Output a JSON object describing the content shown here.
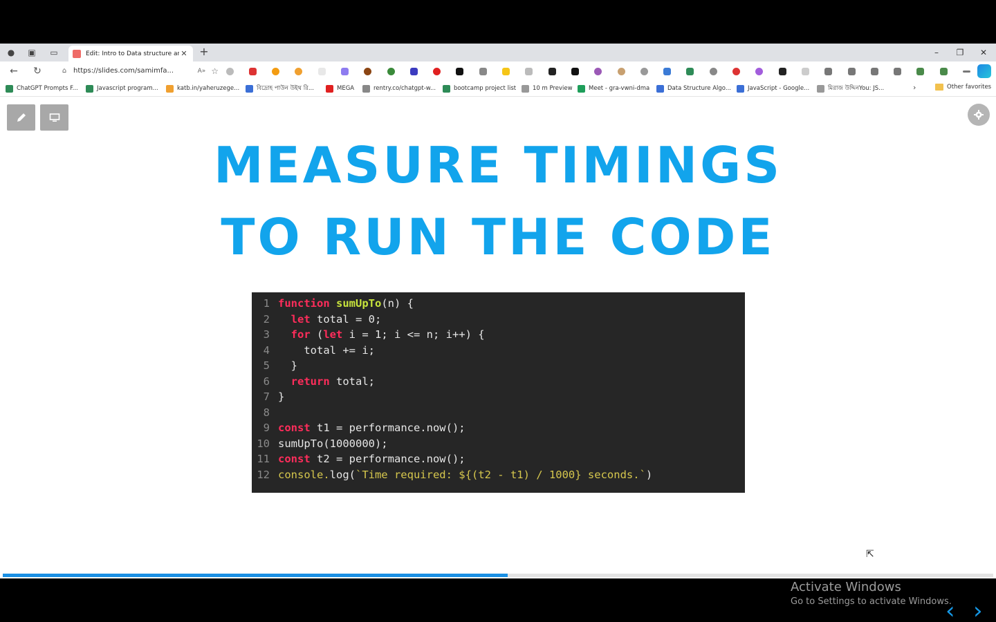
{
  "tab": {
    "title": "Edit: Intro to Data structure and",
    "close": "✕"
  },
  "new_tab": "+",
  "window_controls": {
    "minimize": "–",
    "restore": "❐",
    "close": "✕"
  },
  "nav": {
    "back": "←",
    "refresh": "↻"
  },
  "address": {
    "url": "https://slides.com/samimfa...",
    "read_aloud": "A»",
    "lock": "🔒"
  },
  "bookmarks": [
    {
      "label": "ChatGPT Prompts F...",
      "color": "#2e8b57"
    },
    {
      "label": "Javascript program...",
      "color": "#2e8b57"
    },
    {
      "label": "katb.in/yaheruzege...",
      "color": "#f0a030"
    },
    {
      "label": "বিদ্রোহ পাউন উইথ রি...",
      "color": "#3b6fd6"
    },
    {
      "label": "MEGA",
      "color": "#e02020"
    },
    {
      "label": "rentry.co/chatgpt-w...",
      "color": "#888888"
    },
    {
      "label": "bootcamp project list",
      "color": "#2e8b57"
    },
    {
      "label": "10 m Preview",
      "color": "#999999"
    },
    {
      "label": "Meet - gra-vwni-dma",
      "color": "#1e9e5a"
    },
    {
      "label": "Data Structure Algo...",
      "color": "#3b6fd6"
    },
    {
      "label": "JavaScript - Google...",
      "color": "#3b6fd6"
    },
    {
      "label": "মিরাজ উদ্দিনYou: JS...",
      "color": "#999999"
    }
  ],
  "bookmarks_more": "›",
  "other_favorites": "Other favorites",
  "slide": {
    "heading_line1": "MEASURE TIMINGS",
    "heading_line2": "TO RUN THE CODE",
    "heading_color": "#12a4ec",
    "code_lines": [
      {
        "n": "1",
        "parts": [
          [
            "kw",
            "function"
          ],
          [
            "c",
            " "
          ],
          [
            "fn",
            "sumUpTo"
          ],
          [
            "c",
            "(n) {"
          ]
        ]
      },
      {
        "n": "2",
        "parts": [
          [
            "c",
            "  "
          ],
          [
            "kw",
            "let"
          ],
          [
            "c",
            " total = 0;"
          ]
        ]
      },
      {
        "n": "3",
        "parts": [
          [
            "c",
            "  "
          ],
          [
            "kw",
            "for"
          ],
          [
            "c",
            " ("
          ],
          [
            "kw",
            "let"
          ],
          [
            "c",
            " i = 1; i <= n; i++) {"
          ]
        ]
      },
      {
        "n": "4",
        "parts": [
          [
            "c",
            "    total += i;"
          ]
        ]
      },
      {
        "n": "5",
        "parts": [
          [
            "c",
            "  }"
          ]
        ]
      },
      {
        "n": "6",
        "parts": [
          [
            "c",
            "  "
          ],
          [
            "kw",
            "return"
          ],
          [
            "c",
            " total;"
          ]
        ]
      },
      {
        "n": "7",
        "parts": [
          [
            "c",
            "}"
          ]
        ]
      },
      {
        "n": "8",
        "parts": []
      },
      {
        "n": "9",
        "parts": [
          [
            "kw",
            "const"
          ],
          [
            "c",
            " t1 = performance.now();"
          ]
        ]
      },
      {
        "n": "10",
        "parts": [
          [
            "c",
            "sumUpTo(1000000);"
          ]
        ]
      },
      {
        "n": "11",
        "parts": [
          [
            "kw",
            "const"
          ],
          [
            "c",
            " t2 = performance.now();"
          ]
        ]
      },
      {
        "n": "12",
        "parts": [
          [
            "str",
            "console."
          ],
          [
            "c",
            "log("
          ],
          [
            "str",
            "`Time required: ${(t2 - t1) / 1000} seconds.`"
          ],
          [
            "c",
            ")"
          ]
        ]
      }
    ]
  },
  "watermark": {
    "line1": "Activate Windows",
    "line2": "Go to Settings to activate Windows."
  },
  "nav_arrows": {
    "prev": "‹",
    "next": "›"
  },
  "progress": {
    "fraction": 0.51,
    "color": "#1a8fe3"
  }
}
